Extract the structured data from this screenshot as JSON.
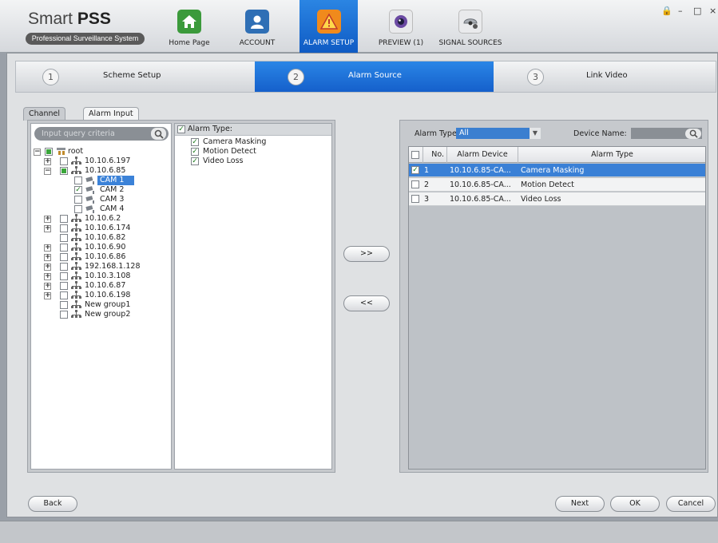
{
  "app": {
    "title": "Smart PSS",
    "title_plain": "Smart ",
    "title_bold": "PSS",
    "subtitle": "Professional Surveillance System"
  },
  "window_controls": {
    "lock": "🔒",
    "minimize": "–",
    "maximize": "□",
    "close": "×"
  },
  "nav_tabs": [
    {
      "label": "Home Page",
      "icon": "home-icon",
      "color": "#3b9a3b"
    },
    {
      "label": "ACCOUNT",
      "icon": "account-icon",
      "color": "#2f6fb5"
    },
    {
      "label": "ALARM SETUP",
      "icon": "alarm-setup-icon",
      "color": "#f08a1c"
    },
    {
      "label": "PREVIEW (1)",
      "icon": "preview-camera-icon",
      "color": "#6b4aa3"
    },
    {
      "label": "SIGNAL SOURCES",
      "icon": "signal-sources-icon",
      "color": "#8d9298"
    }
  ],
  "wizard": {
    "steps": [
      {
        "num": "1",
        "label": "Scheme Setup"
      },
      {
        "num": "2",
        "label": "Alarm Source"
      },
      {
        "num": "3",
        "label": "Link Video"
      }
    ],
    "active": 1
  },
  "panel_tabs": {
    "channel": "Channel",
    "alarm_input": "Alarm Input"
  },
  "search": {
    "placeholder": "Input query criteria"
  },
  "tree": {
    "root": "root",
    "devices": [
      {
        "label": "10.10.6.197"
      },
      {
        "label": "10.10.6.85"
      },
      {
        "label": "10.10.6.2"
      },
      {
        "label": "10.10.6.174"
      },
      {
        "label": "10.10.6.82"
      },
      {
        "label": "10.10.6.90"
      },
      {
        "label": "10.10.6.86"
      },
      {
        "label": "192.168.1.128"
      },
      {
        "label": "10.10.3.108"
      },
      {
        "label": "10.10.6.87"
      },
      {
        "label": "10.10.6.198"
      },
      {
        "label": "New group1"
      },
      {
        "label": "New group2"
      }
    ],
    "cams": [
      {
        "label": "CAM 1",
        "checked": false,
        "selected": true
      },
      {
        "label": "CAM 2",
        "checked": true,
        "selected": false
      },
      {
        "label": "CAM 3",
        "checked": false,
        "selected": false
      },
      {
        "label": "CAM 4",
        "checked": false,
        "selected": false
      }
    ]
  },
  "alarm_types": {
    "header": "Alarm Type:",
    "items": [
      {
        "label": "Camera Masking",
        "checked": true
      },
      {
        "label": "Motion Detect",
        "checked": true
      },
      {
        "label": "Video Loss",
        "checked": true
      }
    ]
  },
  "transfer": {
    "add": ">>",
    "remove": "<<"
  },
  "filter": {
    "alarm_type_label": "Alarm Type:",
    "alarm_type_value": "All",
    "device_name_label": "Device Name:",
    "device_name_value": ""
  },
  "grid": {
    "columns": [
      "No.",
      "Alarm Device",
      "Alarm Type"
    ],
    "rows": [
      {
        "no": "1",
        "device": "10.10.6.85-CA...",
        "type": "Camera Masking",
        "checked": true,
        "selected": true
      },
      {
        "no": "2",
        "device": "10.10.6.85-CA...",
        "type": "Motion Detect",
        "checked": false,
        "selected": false
      },
      {
        "no": "3",
        "device": "10.10.6.85-CA...",
        "type": "Video Loss",
        "checked": false,
        "selected": false
      }
    ]
  },
  "buttons": {
    "back": "Back",
    "next": "Next",
    "ok": "OK",
    "cancel": "Cancel"
  },
  "colors": {
    "accent": "#1a6fd6",
    "selection": "#3a80d6"
  }
}
